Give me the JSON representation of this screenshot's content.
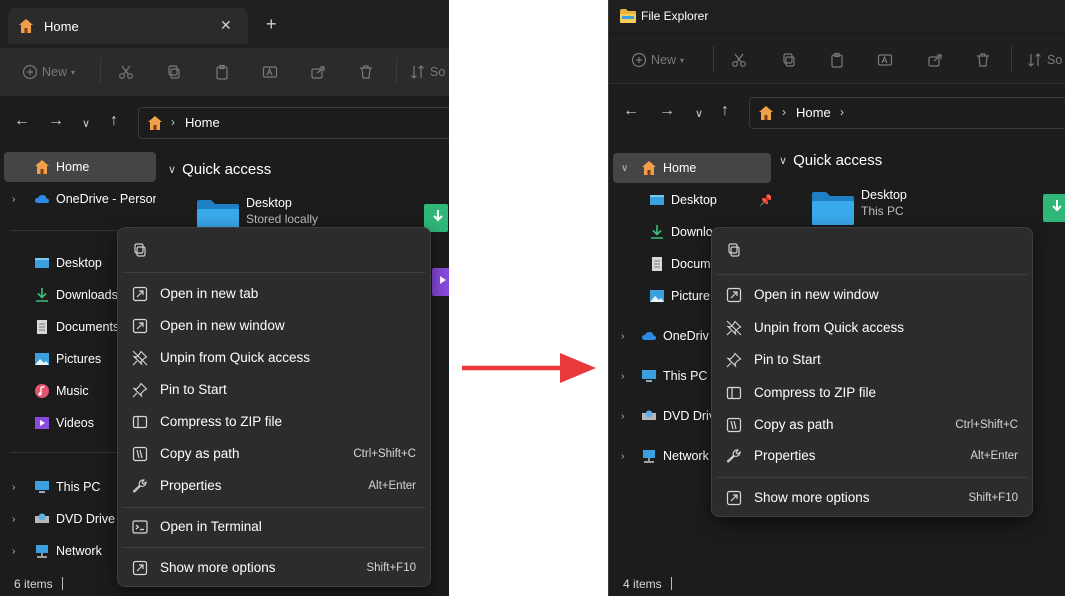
{
  "left": {
    "tab": {
      "label": "Home",
      "close": "✕",
      "new_tab": "+"
    },
    "toolbar": {
      "new_label": "New",
      "sort_label": "So"
    },
    "address": {
      "crumb": "Home"
    },
    "nav": {
      "home": "Home",
      "onedrive": "OneDrive - Persona",
      "desktop": "Desktop",
      "downloads": "Downloads",
      "documents": "Documents",
      "pictures": "Pictures",
      "music": "Music",
      "videos": "Videos",
      "this_pc": "This PC",
      "dvd": "DVD Drive (",
      "network": "Network"
    },
    "quick_access": "Quick access",
    "tile": {
      "name": "Desktop",
      "sub": "Stored locally"
    },
    "status": "6 items",
    "menu": {
      "items": [
        {
          "label": "Open in new tab",
          "shortcut": ""
        },
        {
          "label": "Open in new window",
          "shortcut": ""
        },
        {
          "label": "Unpin from Quick access",
          "shortcut": ""
        },
        {
          "label": "Pin to Start",
          "shortcut": ""
        },
        {
          "label": "Compress to ZIP file",
          "shortcut": ""
        },
        {
          "label": "Copy as path",
          "shortcut": "Ctrl+Shift+C"
        },
        {
          "label": "Properties",
          "shortcut": "Alt+Enter"
        },
        {
          "label": "Open in Terminal",
          "shortcut": ""
        },
        {
          "label": "Show more options",
          "shortcut": "Shift+F10"
        }
      ]
    }
  },
  "right": {
    "title": "File Explorer",
    "toolbar": {
      "new_label": "New",
      "sort_label": "So"
    },
    "address": {
      "crumb": "Home"
    },
    "nav": {
      "home": "Home",
      "desktop": "Desktop",
      "downloads": "Downlo",
      "documents": "Docum",
      "pictures": "Picture",
      "onedrive": "OneDriv",
      "this_pc": "This PC",
      "dvd": "DVD Driv",
      "network": "Network"
    },
    "quick_access": "Quick access",
    "tile": {
      "name": "Desktop",
      "sub": "This PC"
    },
    "status": "4 items",
    "menu": {
      "items": [
        {
          "label": "Open in new window",
          "shortcut": ""
        },
        {
          "label": "Unpin from Quick access",
          "shortcut": ""
        },
        {
          "label": "Pin to Start",
          "shortcut": ""
        },
        {
          "label": "Compress to ZIP file",
          "shortcut": ""
        },
        {
          "label": "Copy as path",
          "shortcut": "Ctrl+Shift+C"
        },
        {
          "label": "Properties",
          "shortcut": "Alt+Enter"
        },
        {
          "label": "Show more options",
          "shortcut": "Shift+F10"
        }
      ]
    }
  },
  "colors": {
    "window_bg": "#1c1c1c",
    "menu_bg": "#2c2c2c",
    "selected_bg": "#454545",
    "arrow": "#e8393b",
    "folder_blue": "#3aa0e0",
    "home_orange": "#f0a04a"
  }
}
